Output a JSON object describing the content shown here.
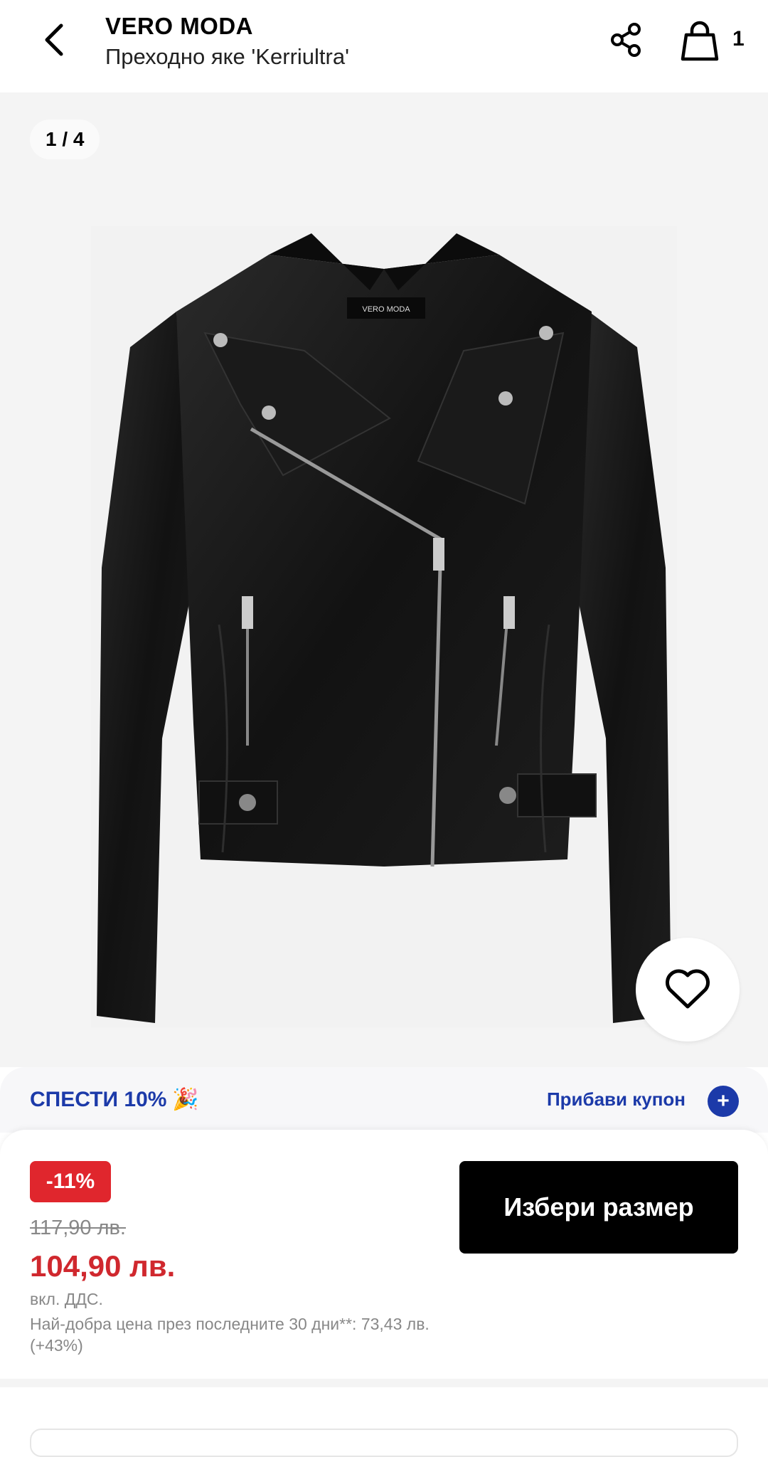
{
  "header": {
    "brand": "VERO MODA",
    "product_name": "Преходно яке 'Kerriultra'",
    "bag_count": "1"
  },
  "gallery": {
    "pager": "1 / 4",
    "image_logo_text": "VERO MODA"
  },
  "coupon": {
    "text": "СПЕСТИ 10%",
    "emoji": "🎉",
    "link": "Прибави купон",
    "plus": "+"
  },
  "price": {
    "discount": "-11%",
    "old": "117,90 лв.",
    "new": "104,90 лв.",
    "vat": "вкл. ДДС.",
    "best_price": "Най-добра цена през последните 30 дни**: 73,43 лв. (+43%)"
  },
  "actions": {
    "choose_size": "Избери размер"
  },
  "colors": {
    "accent_blue": "#1c3aa9",
    "sale_red": "#d0282e",
    "badge_red": "#e0262d"
  }
}
